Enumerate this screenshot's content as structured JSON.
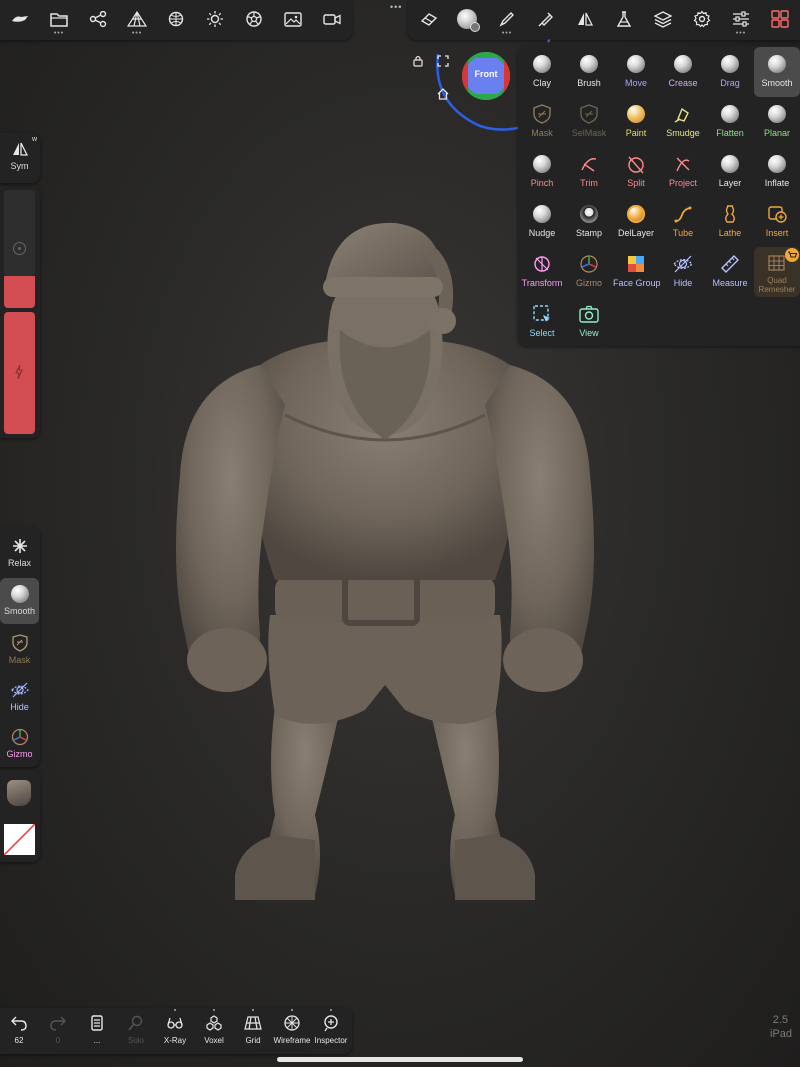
{
  "top_handle": "•••",
  "top_left_toolbar": [
    {
      "name": "scene-icon"
    },
    {
      "name": "files-icon"
    },
    {
      "name": "scene-tree-icon"
    },
    {
      "name": "topology-icon"
    },
    {
      "name": "texture-sphere-icon"
    },
    {
      "name": "lighting-icon"
    },
    {
      "name": "material-icon"
    },
    {
      "name": "background-image-icon"
    },
    {
      "name": "video-icon"
    }
  ],
  "top_right_toolbar": [
    {
      "name": "eraser-icon"
    },
    {
      "name": "smooth-brush-icon"
    },
    {
      "name": "brush-settings-icon"
    },
    {
      "name": "stroke-icon"
    },
    {
      "name": "symmetry-icon"
    },
    {
      "name": "flask-icon"
    },
    {
      "name": "layers-icon"
    },
    {
      "name": "settings-icon"
    },
    {
      "name": "sliders-icon"
    },
    {
      "name": "tools-grid-icon"
    }
  ],
  "gizmo": {
    "face_label": "Front"
  },
  "tools": [
    {
      "label": "Clay",
      "color": "#e6e6e6",
      "kind": "sphere"
    },
    {
      "label": "Brush",
      "color": "#e6e6e6",
      "kind": "sphere"
    },
    {
      "label": "Move",
      "color": "#a9a6ff",
      "kind": "sphere"
    },
    {
      "label": "Crease",
      "color": "#d8a8ff",
      "kind": "sphere"
    },
    {
      "label": "Drag",
      "color": "#a9a6ff",
      "kind": "sphere"
    },
    {
      "label": "Smooth",
      "color": "#e6e6e6",
      "kind": "sphere",
      "selected": true
    },
    {
      "label": "Mask",
      "color": "#8e7a5c",
      "kind": "mask"
    },
    {
      "label": "SelMask",
      "color": "#6c6450",
      "kind": "mask"
    },
    {
      "label": "Paint",
      "color": "#f0d66a",
      "kind": "paint"
    },
    {
      "label": "Smudge",
      "color": "#e8e28a",
      "kind": "smudge"
    },
    {
      "label": "Flatten",
      "color": "#8fe38a",
      "kind": "sphere"
    },
    {
      "label": "Planar",
      "color": "#8fe38a",
      "kind": "sphere"
    },
    {
      "label": "Pinch",
      "color": "#ff8b8b",
      "kind": "sphere"
    },
    {
      "label": "Trim",
      "color": "#ff8b8b",
      "kind": "trim"
    },
    {
      "label": "Split",
      "color": "#ff8b8b",
      "kind": "split"
    },
    {
      "label": "Project",
      "color": "#ff8b8b",
      "kind": "project"
    },
    {
      "label": "Layer",
      "color": "#e6e6e6",
      "kind": "sphere"
    },
    {
      "label": "Inflate",
      "color": "#e6e6e6",
      "kind": "sphere"
    },
    {
      "label": "Nudge",
      "color": "#e6e6e6",
      "kind": "sphere"
    },
    {
      "label": "Stamp",
      "color": "#e6e6e6",
      "kind": "stamp"
    },
    {
      "label": "DelLayer",
      "color": "#e6e6e6",
      "kind": "dellayer"
    },
    {
      "label": "Tube",
      "color": "#f0a83a",
      "kind": "tube"
    },
    {
      "label": "Lathe",
      "color": "#f0a83a",
      "kind": "lathe"
    },
    {
      "label": "Insert",
      "color": "#f0a83a",
      "kind": "insert"
    },
    {
      "label": "Transform",
      "color": "#ff9cf2",
      "kind": "transform"
    },
    {
      "label": "Gizmo",
      "color": "#b28960",
      "kind": "gizmo"
    },
    {
      "label": "Face Group",
      "color": "#b8c2ff",
      "kind": "facegroup"
    },
    {
      "label": "Hide",
      "color": "#b8c2ff",
      "kind": "hide"
    },
    {
      "label": "Measure",
      "color": "#b8c2ff",
      "kind": "measure"
    },
    {
      "label": "Quad Remesher",
      "color": "#a07e5a",
      "kind": "quad"
    },
    {
      "label": "Select",
      "color": "#8fd9ff",
      "kind": "select"
    },
    {
      "label": "View",
      "color": "#8ff0c8",
      "kind": "view"
    }
  ],
  "left_panel": {
    "sym_label": "Sym",
    "sym_hotkey": "w",
    "tools": [
      {
        "label": "Relax",
        "color": "#e6e6e6"
      },
      {
        "label": "Smooth",
        "color": "#e6e6e6"
      },
      {
        "label": "Mask",
        "color": "#8e7a5c"
      },
      {
        "label": "Hide",
        "color": "#b8c2ff"
      },
      {
        "label": "Gizmo",
        "color": "#ff9cf2"
      }
    ]
  },
  "bottom_bar": [
    {
      "label": "62",
      "icon": "undo-icon"
    },
    {
      "label": "0",
      "icon": "redo-icon"
    },
    {
      "label": "...",
      "icon": "history-icon"
    },
    {
      "label": "Solo",
      "icon": "solo-icon"
    },
    {
      "label": "X-Ray",
      "icon": "xray-icon"
    },
    {
      "label": "Voxel",
      "icon": "voxel-icon"
    },
    {
      "label": "Grid",
      "icon": "grid-icon"
    },
    {
      "label": "Wireframe",
      "icon": "wireframe-icon"
    },
    {
      "label": "Inspector",
      "icon": "inspector-icon"
    }
  ],
  "version": {
    "number": "2.5",
    "device": "iPad"
  }
}
